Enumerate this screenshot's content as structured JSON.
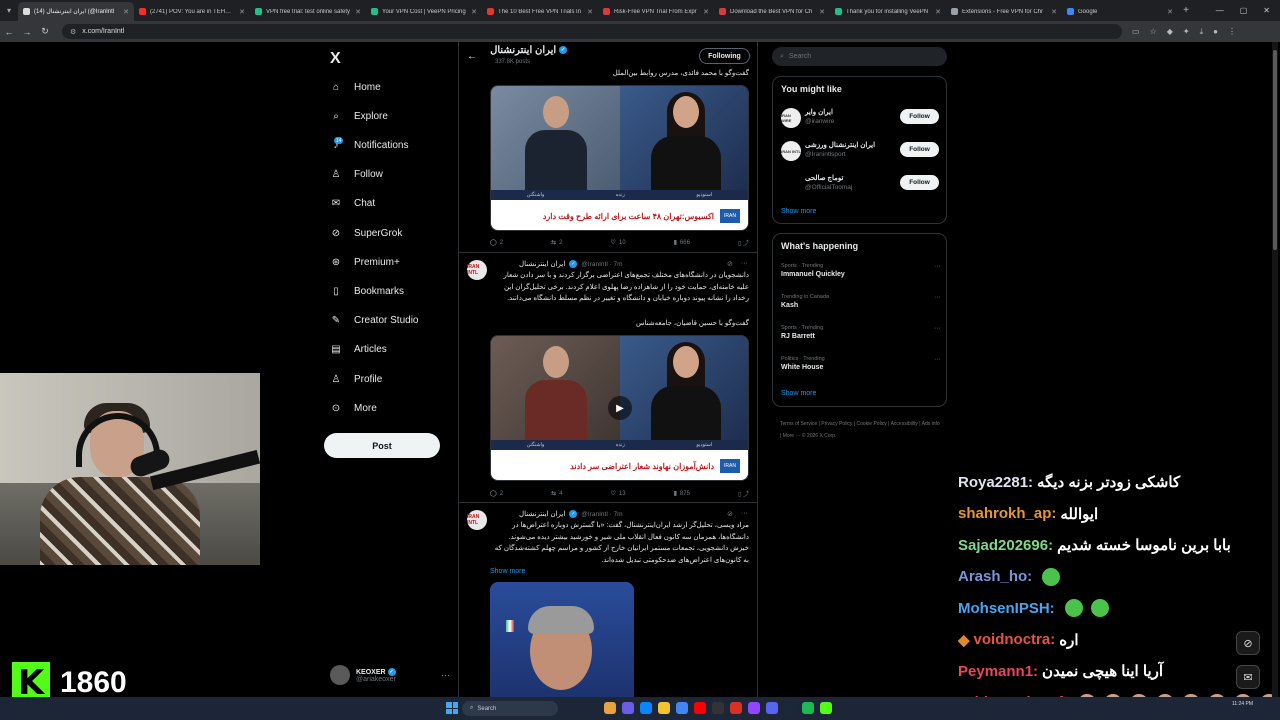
{
  "browser": {
    "tabs": [
      {
        "title": "(14) ایران اینترنشنال (@IranIntl",
        "color": "#dddddd",
        "active": true
      },
      {
        "title": "(2741) POV: You are in TEHRAN",
        "color": "#ff2a2a",
        "active": false
      },
      {
        "title": "VPN free trial: test online safety",
        "color": "#21c08b",
        "active": false
      },
      {
        "title": "Your VPN Cost | VeePN Pricing",
        "color": "#21c08b",
        "active": false
      },
      {
        "title": "The 10 Best Free VPN Trials In",
        "color": "#e2362c",
        "active": false
      },
      {
        "title": "Risk-Free VPN Trial From Expr",
        "color": "#da3940",
        "active": false
      },
      {
        "title": "Download the Best VPN for Ch",
        "color": "#da3940",
        "active": false
      },
      {
        "title": "Thank you for installing VeePN",
        "color": "#21c08b",
        "active": false
      },
      {
        "title": "Extensions - Free VPN for Chr",
        "color": "#9aa0a6",
        "active": false
      },
      {
        "title": "Google",
        "color": "#4285f4",
        "active": false
      }
    ],
    "url": "x.com/IranIntl"
  },
  "nav": {
    "logo": "X",
    "items": [
      {
        "label": "Home",
        "icon": "home-icon"
      },
      {
        "label": "Explore",
        "icon": "search-icon"
      },
      {
        "label": "Notifications",
        "icon": "bell-icon"
      },
      {
        "label": "Follow",
        "icon": "person-add-icon"
      },
      {
        "label": "Chat",
        "icon": "mail-icon"
      },
      {
        "label": "SuperGrok",
        "icon": "grok-icon"
      },
      {
        "label": "Premium+",
        "icon": "premium-icon"
      },
      {
        "label": "Bookmarks",
        "icon": "bookmark-icon"
      },
      {
        "label": "Creator Studio",
        "icon": "creator-icon"
      },
      {
        "label": "Articles",
        "icon": "articles-icon"
      },
      {
        "label": "Profile",
        "icon": "profile-icon"
      },
      {
        "label": "More",
        "icon": "more-icon"
      }
    ],
    "notif_count": "14",
    "post_label": "Post",
    "account_name": "KEOXER",
    "account_handle": "@ariakeoxer"
  },
  "timeline": {
    "title": "ایران اینترنشنال",
    "subtitle": "337.8K posts",
    "following_label": "Following",
    "tweet0": {
      "text": "گفت‌وگو با محمد فائدی، مدرس روابط بین‌الملل",
      "banner": "اکسیوس:تهران ۴۸ ساعت برای ارائه طرح وقت دارد",
      "strip_left": "واشنگتن",
      "strip_mid": "زنده",
      "strip_right": "استودیو",
      "replies": "2",
      "reposts": "2",
      "likes": "10",
      "views": "666"
    },
    "tweet1": {
      "name": "ایران اینترنشنال",
      "handle": "@IranIntl · 7m",
      "text": "دانشجویان در دانشگاه‌های مختلف تجمع‌های اعتراضی برگزار کردند و با سر دادن شعار علیه خامنه‌ای، حمایت خود را از شاهزاده رضا پهلوی اعلام کردند. برخی تحلیل‌گران این رخداد را نشانه پیوند دوباره خیابان و دانشگاه و تغییر در نظم مسلط دانشگاه می‌دانند.",
      "text2": "گفت‌وگو با حسین قاضیان، جامعه‌شناس",
      "banner": "دانش‌آموزان نهاوند شعار اعتراضی سر دادند",
      "strip_left": "واشنگتن",
      "strip_mid": "زنده",
      "strip_right": "استودیو",
      "replies": "2",
      "reposts": "4",
      "likes": "13",
      "views": "875"
    },
    "tweet2": {
      "name": "ایران اینترنشنال",
      "handle": "@IranIntl · 7m",
      "text": "مراد ویسی، تحلیل‌گر ارشد ایران‌اینترنشنال، گفت: «با گسترش دوباره اعتراض‌ها در دانشگاه‌ها، همزمان سه کانون فعال انقلاب ملی شیر و خورشید بیشتر دیده می‌شوند. خیزش دانشجویی، تجمعات مستمر ایرانیان خارج از کشور و مراسم چهلم کشته‌شدگان که به کانون‌های اعتراض‌های ضدحکومتی تبدیل شده‌اند.",
      "show_more": "Show more"
    },
    "avatar_text": "IRAN INTL"
  },
  "sidebar": {
    "search_placeholder": "Search",
    "you_might_like": "You might like",
    "suggestions": [
      {
        "name": "ایران وایر",
        "handle": "@iranwire",
        "follow": "Follow",
        "avatar": "IRAN WIRE"
      },
      {
        "name": "ایران اینترنشنال ورزشی",
        "handle": "@Iranintlsport",
        "follow": "Follow",
        "avatar": "IRAN INTL"
      },
      {
        "name": "توماج صالحی",
        "handle": "@OfficialToomaj",
        "follow": "Follow",
        "avatar": ""
      }
    ],
    "show_more": "Show more",
    "whats_happening": "What's happening",
    "trends": [
      {
        "context": "Sports · Trending",
        "name": "Immanuel Quickley"
      },
      {
        "context": "Trending in Canada",
        "name": "Kash"
      },
      {
        "context": "Sports · Trending",
        "name": "RJ Barrett"
      },
      {
        "context": "Politics · Trending",
        "name": "White House"
      }
    ],
    "show_more2": "Show more",
    "footer": "Terms of Service | Privacy Policy | Cookie Policy | Accessibility | Ads info | More ··· © 2026 X Corp."
  },
  "stream": {
    "kick_count": "1860",
    "chat": [
      {
        "user": "Roya2281:",
        "color": "#dfe3f0",
        "msg": "کاشکی زودتر بزنه دیگه"
      },
      {
        "user": "shahrokh_ap:",
        "color": "#e8943a",
        "msg": "ایوالله"
      },
      {
        "user": "Sajad202696:",
        "color": "#7fd889",
        "msg": "بابا برین ناموسا خسته شدیم"
      },
      {
        "user": "Arash_ho:",
        "color": "#7b95d8",
        "msg": ""
      },
      {
        "user": "MohsenIPSH:",
        "color": "#4aa4f0",
        "msg": ""
      },
      {
        "user": "voidnoctra:",
        "color": "#e5563f",
        "msg": "اره"
      },
      {
        "user": "Peymann1:",
        "color": "#e8465a",
        "msg": "آریا اینا هیچی نمیدن"
      },
      {
        "user": "ashkan_sharaf:",
        "color": "#e8465a",
        "msg": ""
      }
    ]
  },
  "taskbar": {
    "search_label": "Search",
    "time": "11:24 PM"
  }
}
